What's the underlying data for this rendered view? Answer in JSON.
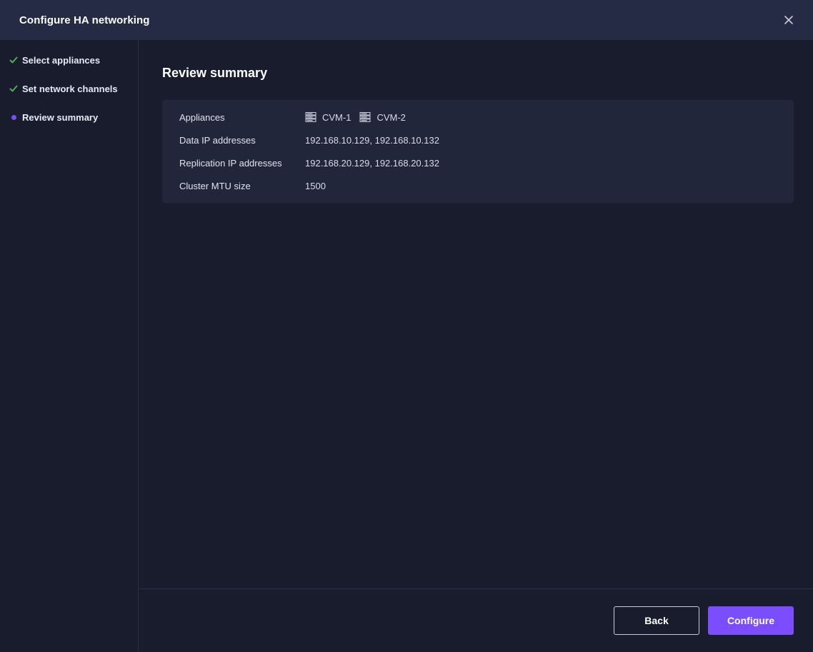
{
  "header": {
    "title": "Configure HA networking"
  },
  "steps": [
    {
      "label": "Select appliances",
      "status": "complete"
    },
    {
      "label": "Set network channels",
      "status": "complete"
    },
    {
      "label": "Review summary",
      "status": "current"
    }
  ],
  "main": {
    "title": "Review summary",
    "summary": {
      "appliances_label": "Appliances",
      "appliances": [
        "CVM-1",
        "CVM-2"
      ],
      "data_ip_label": "Data IP addresses",
      "data_ip_value": "192.168.10.129, 192.168.10.132",
      "replication_ip_label": "Replication IP addresses",
      "replication_ip_value": "192.168.20.129, 192.168.20.132",
      "mtu_label": "Cluster MTU size",
      "mtu_value": "1500"
    }
  },
  "footer": {
    "back_label": "Back",
    "configure_label": "Configure"
  },
  "colors": {
    "accent": "#7c4dff",
    "check": "#4caf50",
    "header_bg": "#252b45",
    "page_bg": "#191c2d",
    "card_bg": "#22263a"
  }
}
